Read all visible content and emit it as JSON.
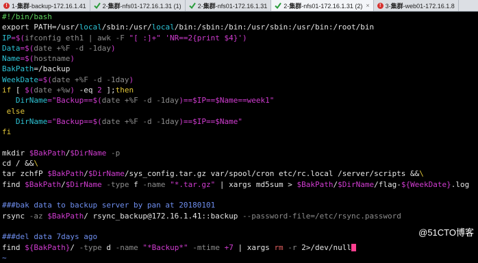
{
  "tabs": [
    {
      "prefix": "1-",
      "bold": "集群",
      "rest": "-backup-172.16.1.41",
      "status": "error"
    },
    {
      "prefix": "2-",
      "bold": "集群",
      "rest": "-nfs01-172.16.1.31 (1)",
      "status": "ok"
    },
    {
      "prefix": "2-",
      "bold": "集群",
      "rest": "-nfs01-172.16.1.31",
      "status": "ok"
    },
    {
      "prefix": "2-",
      "bold": "集群",
      "rest": "-nfs01-172.16.1.31 (2)",
      "status": "ok",
      "active": true,
      "close": "×"
    },
    {
      "prefix": "3-",
      "bold": "集群",
      "rest": "-web01-172.16.1.8",
      "status": "error"
    }
  ],
  "terminal": {
    "lines": [
      [
        [
          "c-green",
          "#!/bin/bash"
        ]
      ],
      [
        [
          "c-white",
          "export PATH=/usr/"
        ],
        [
          "c-cyan",
          "local"
        ],
        [
          "c-white",
          "/sbin:/usr/"
        ],
        [
          "c-cyan",
          "local"
        ],
        [
          "c-white",
          "/bin:/sbin:/bin:/usr/sbin:/usr/bin:/root/bin"
        ]
      ],
      [
        [
          "c-cyan",
          "IP"
        ],
        [
          "c-magenta",
          "=$("
        ],
        [
          "c-grey",
          "ifconfig eth1 | awk -F "
        ],
        [
          "c-magenta",
          "\"[ :]+\" 'NR==2{print $4}'"
        ],
        [
          "c-magenta",
          ")"
        ]
      ],
      [
        [
          "c-cyan",
          "Data"
        ],
        [
          "c-magenta",
          "=$("
        ],
        [
          "c-grey",
          "date +%F -d -1day"
        ],
        [
          "c-magenta",
          ")"
        ]
      ],
      [
        [
          "c-cyan",
          "Name"
        ],
        [
          "c-magenta",
          "=$("
        ],
        [
          "c-grey",
          "hostname"
        ],
        [
          "c-magenta",
          ")"
        ]
      ],
      [
        [
          "c-cyan",
          "BakPath"
        ],
        [
          "c-white",
          "=/backup"
        ]
      ],
      [
        [
          "c-cyan",
          "WeekDate"
        ],
        [
          "c-magenta",
          "=$("
        ],
        [
          "c-grey",
          "date +%F -d -1day"
        ],
        [
          "c-magenta",
          ")"
        ]
      ],
      [
        [
          "c-yellow",
          "if"
        ],
        [
          "c-white",
          " [ "
        ],
        [
          "c-magenta",
          "$("
        ],
        [
          "c-grey",
          "date +%w"
        ],
        [
          "c-magenta",
          ")"
        ],
        [
          "c-white",
          " -eq "
        ],
        [
          "c-magenta",
          "2"
        ],
        [
          "c-white",
          " ];"
        ],
        [
          "c-yellow",
          "then"
        ]
      ],
      [
        [
          "c-white",
          "   "
        ],
        [
          "c-cyan",
          "DirName"
        ],
        [
          "c-magenta",
          "=\"Backup==$("
        ],
        [
          "c-grey",
          "date +%F -d -1day"
        ],
        [
          "c-magenta",
          ")==$IP==$Name==week1\""
        ]
      ],
      [
        [
          "c-yellow",
          " else"
        ]
      ],
      [
        [
          "c-white",
          "   "
        ],
        [
          "c-cyan",
          "DirName"
        ],
        [
          "c-magenta",
          "=\"Backup==$("
        ],
        [
          "c-grey",
          "date +%F -d -1day"
        ],
        [
          "c-magenta",
          ")==$IP==$Name\""
        ]
      ],
      [
        [
          "c-yellow",
          "fi"
        ]
      ],
      [
        [
          "c-white",
          ""
        ]
      ],
      [
        [
          "c-white",
          "mkdir "
        ],
        [
          "c-magenta",
          "$BakPath"
        ],
        [
          "c-white",
          "/"
        ],
        [
          "c-magenta",
          "$DirName"
        ],
        [
          "c-grey",
          " -p"
        ]
      ],
      [
        [
          "c-white",
          "cd / &&"
        ],
        [
          "c-yellow",
          "\\"
        ]
      ],
      [
        [
          "c-white",
          "tar zchfP "
        ],
        [
          "c-magenta",
          "$BakPath"
        ],
        [
          "c-white",
          "/"
        ],
        [
          "c-magenta",
          "$DirName"
        ],
        [
          "c-white",
          "/sys_config.tar.gz var/spool/cron etc/rc.local /server/scripts &&"
        ],
        [
          "c-yellow",
          "\\"
        ]
      ],
      [
        [
          "c-white",
          "find "
        ],
        [
          "c-magenta",
          "$BakPath"
        ],
        [
          "c-white",
          "/"
        ],
        [
          "c-magenta",
          "$DirName"
        ],
        [
          "c-grey",
          " -type "
        ],
        [
          "c-white",
          "f "
        ],
        [
          "c-grey",
          "-name "
        ],
        [
          "c-magenta",
          "\"*.tar.gz\""
        ],
        [
          "c-white",
          " | xargs md5sum > "
        ],
        [
          "c-magenta",
          "$BakPath"
        ],
        [
          "c-white",
          "/"
        ],
        [
          "c-magenta",
          "$DirName"
        ],
        [
          "c-white",
          "/flag-"
        ],
        [
          "c-magenta",
          "${WeekDate}"
        ],
        [
          "c-white",
          ".log"
        ]
      ],
      [
        [
          "c-white",
          ""
        ]
      ],
      [
        [
          "c-blue",
          "###bak data to backup server by pan at 20180101"
        ]
      ],
      [
        [
          "c-white",
          "rsync "
        ],
        [
          "c-grey",
          "-az "
        ],
        [
          "c-magenta",
          "$BakPath"
        ],
        [
          "c-white",
          "/ rsync_backup@172.16.1.41::backup "
        ],
        [
          "c-grey",
          "--password-file=/etc/rsync.password"
        ]
      ],
      [
        [
          "c-white",
          ""
        ]
      ],
      [
        [
          "c-blue",
          "###del data 7days ago"
        ]
      ],
      [
        [
          "c-white",
          "find "
        ],
        [
          "c-magenta",
          "${BakPath}"
        ],
        [
          "c-white",
          "/ "
        ],
        [
          "c-grey",
          "-type "
        ],
        [
          "c-white",
          "d "
        ],
        [
          "c-grey",
          "-name "
        ],
        [
          "c-magenta",
          "\"*Backup*\""
        ],
        [
          "c-grey",
          " -mtime "
        ],
        [
          "c-magenta",
          "+7"
        ],
        [
          "c-white",
          " | xargs "
        ],
        [
          "c-red",
          "rm"
        ],
        [
          "c-grey",
          " -r "
        ],
        [
          "c-white",
          "2>/dev/null"
        ]
      ],
      [
        [
          "c-blue",
          "~"
        ]
      ]
    ]
  },
  "watermark": "@51CTO博客"
}
